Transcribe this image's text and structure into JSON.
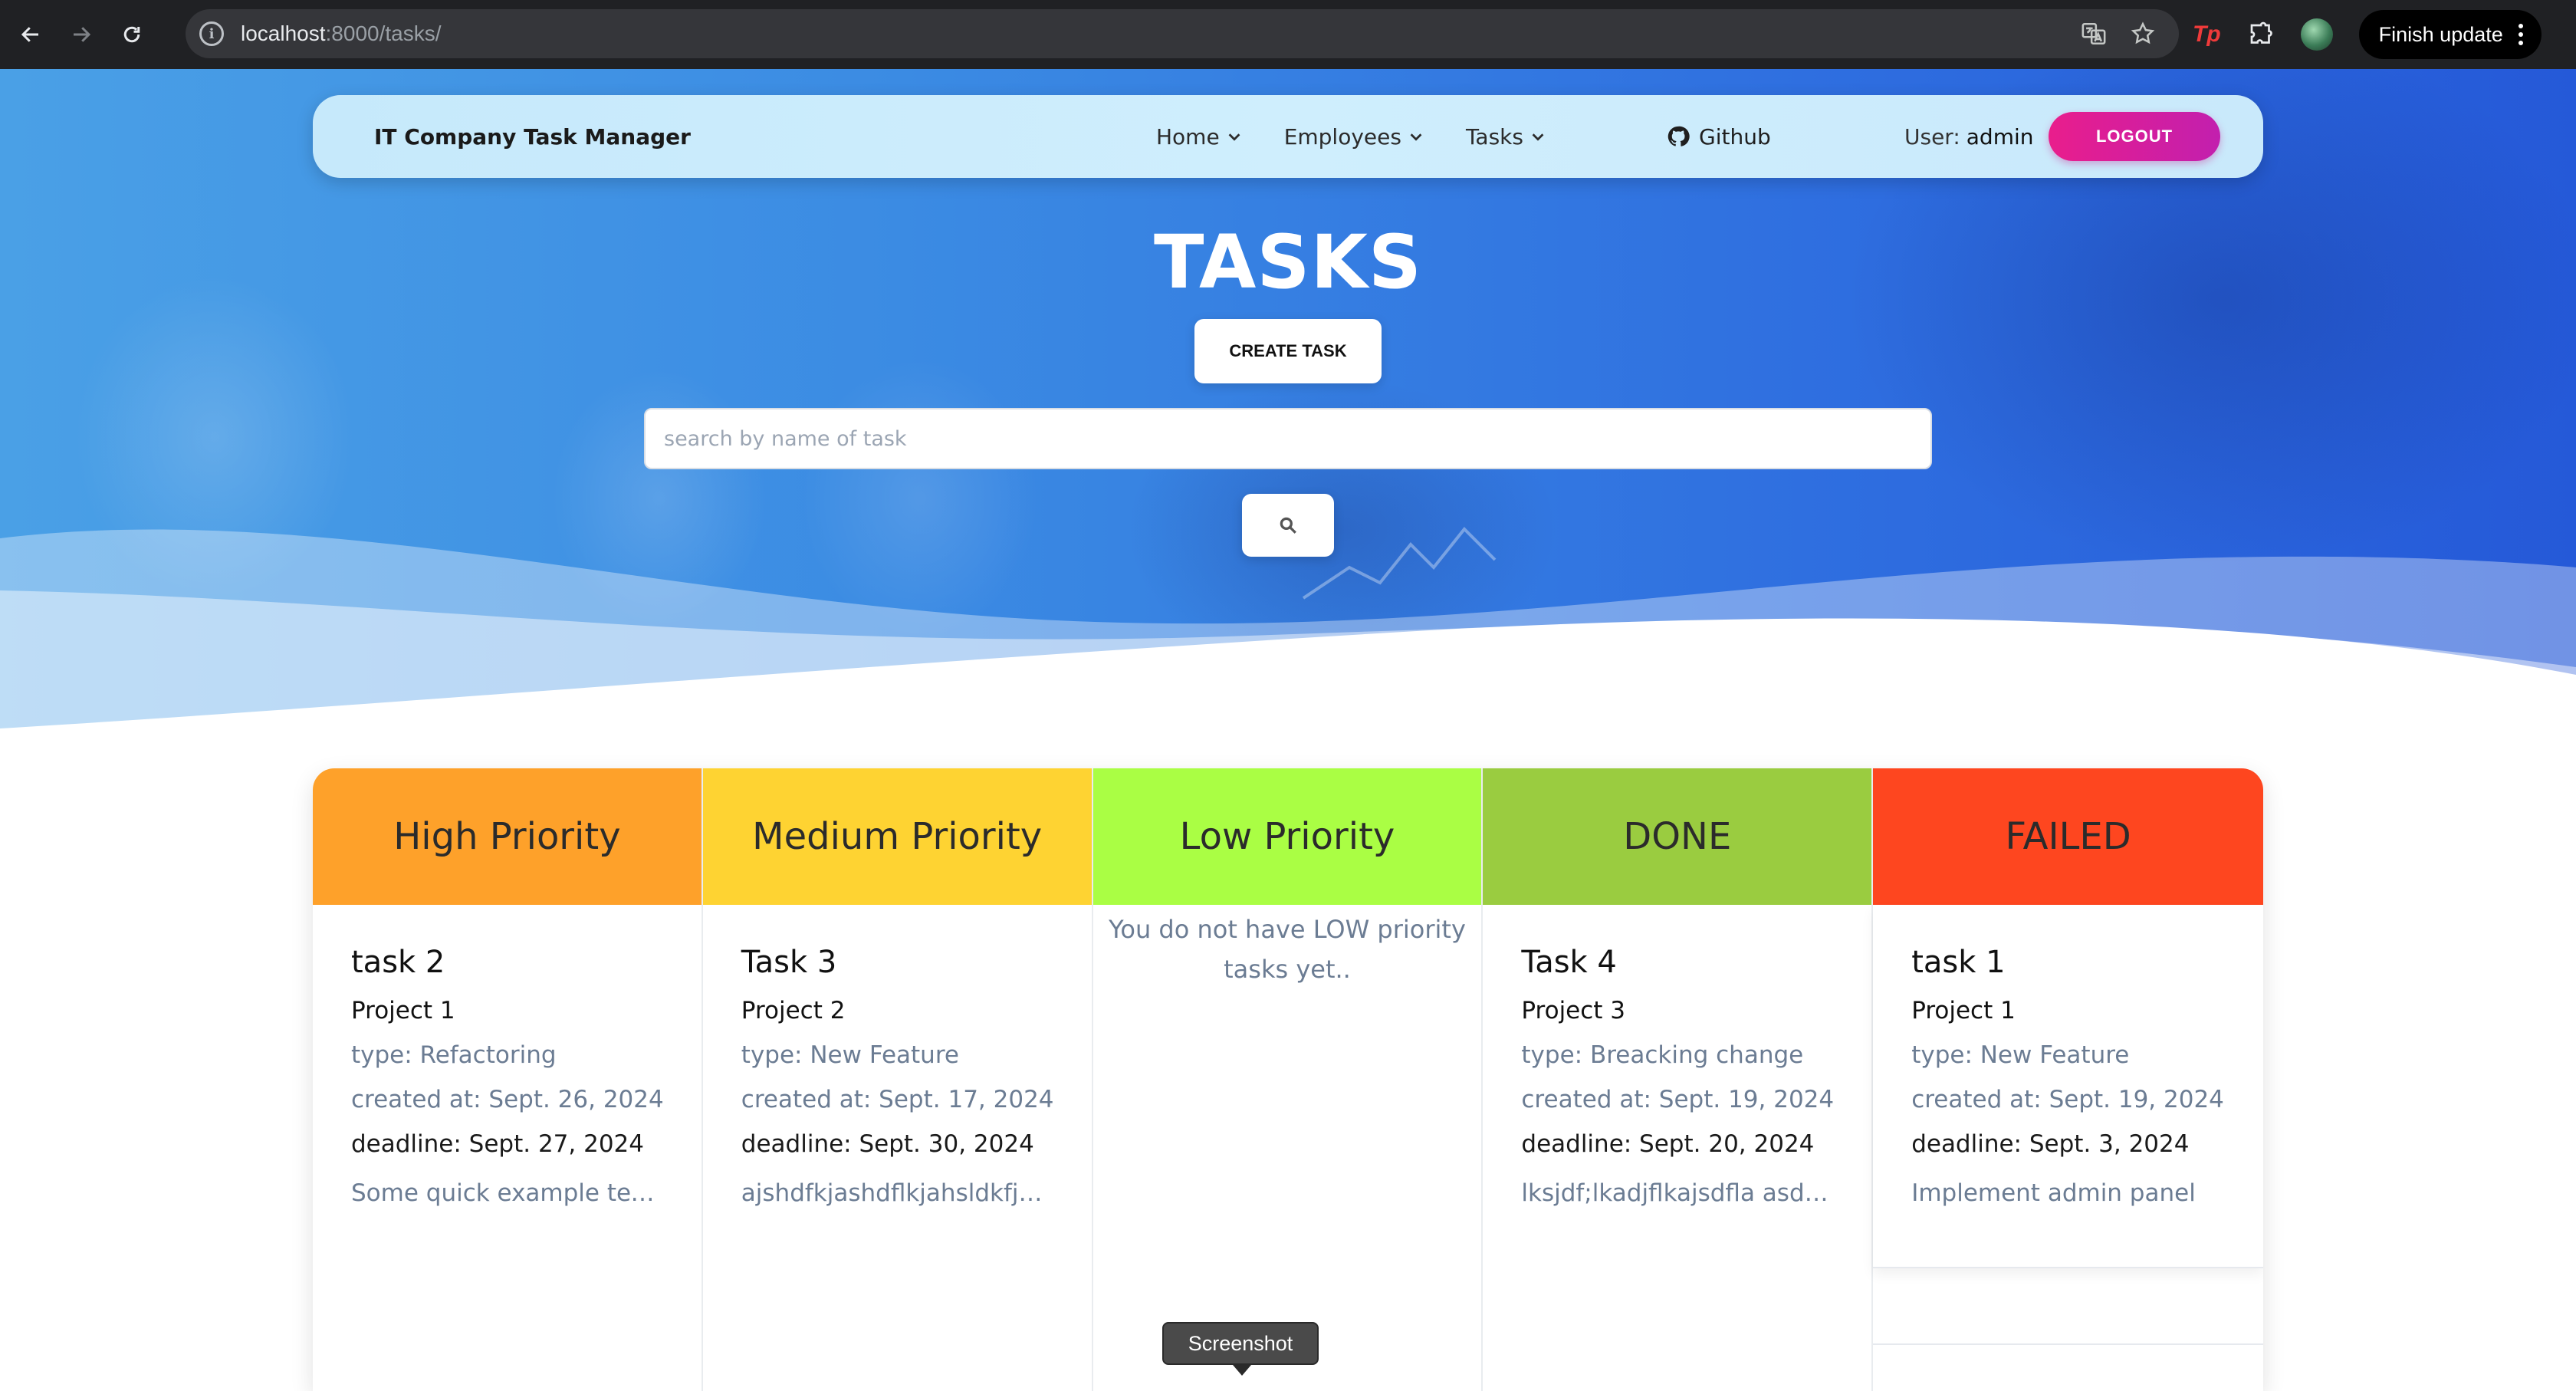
{
  "browser": {
    "url_host": "localhost",
    "url_path": ":8000/tasks/",
    "finish_update_label": "Finish update",
    "extension_label": "Tp"
  },
  "navbar": {
    "brand": "IT Company Task Manager",
    "menu": [
      {
        "label": "Home"
      },
      {
        "label": "Employees"
      },
      {
        "label": "Tasks"
      }
    ],
    "github_label": "Github",
    "user_prefix": "User:",
    "user_name": "admin",
    "logout_label": "LOGOUT"
  },
  "hero": {
    "title": "TASKS",
    "create_label": "CREATE TASK",
    "search_placeholder": "search by name of task"
  },
  "columns": [
    {
      "title": "High Priority",
      "color": "#fea12a",
      "task": {
        "name": "task 2",
        "project": "Project 1",
        "type": "type: Refactoring",
        "created": "created at: Sept. 26, 2024",
        "deadline": "deadline: Sept. 27, 2024",
        "description": "Some quick example text to build on the card"
      }
    },
    {
      "title": "Medium Priority",
      "color": "#fed332",
      "task": {
        "name": "Task 3",
        "project": "Project 2",
        "type": "type: New Feature",
        "created": "created at: Sept. 17, 2024",
        "deadline": "deadline: Sept. 30, 2024",
        "description": "ajshdfkjashdflkjahsldkfjhalskdjfh"
      }
    },
    {
      "title": "Low Priority",
      "color": "#aafe44",
      "empty_text": "You do not have LOW priority tasks yet.."
    },
    {
      "title": "DONE",
      "color": "#9acc40",
      "task": {
        "name": "Task 4",
        "project": "Project 3",
        "type": "type: Breacking change",
        "created": "created at: Sept. 19, 2024",
        "deadline": "deadline: Sept. 20, 2024",
        "description": "lksjdf;lkadjflkajsdfla asdlkfjasdf"
      }
    },
    {
      "title": "FAILED",
      "color": "#fe461f",
      "task": {
        "name": "task 1",
        "project": "Project 1",
        "type": "type: New Feature",
        "created": "created at: Sept. 19, 2024",
        "deadline": "deadline: Sept. 3, 2024",
        "description": "Implement admin panel"
      }
    }
  ],
  "tooltip": "Screenshot"
}
